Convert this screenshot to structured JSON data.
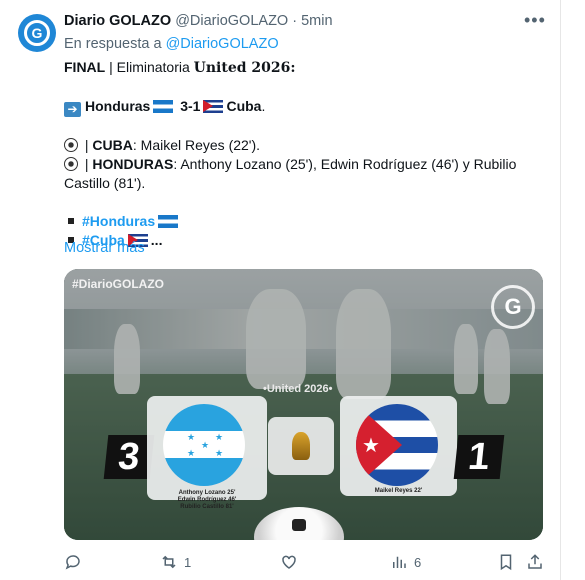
{
  "tweet": {
    "author_name": "Diario GOLAZO",
    "author_handle": "@DiarioGOLAZO",
    "time": "· 5min",
    "reply_prefix": "En respuesta a",
    "reply_to": "@DiarioGOLAZO",
    "final_label": "FINAL",
    "final_sep": " | Eliminatoria ",
    "final_event": "United 2026:",
    "score_team1": "Honduras",
    "score_text": "3-1",
    "score_team2": "Cuba",
    "cuba_label": "CUBA",
    "cuba_scorers": ": Maikel Reyes (22').",
    "honduras_label": "HONDURAS",
    "honduras_scorers_1": ": Anthony Lozano (25'), Edwin Rodríguez (46') y Rubilio",
    "honduras_scorers_2": "Castillo (81').",
    "hashtag1": "#Honduras",
    "hashtag2": "#Cuba",
    "hashtag2_tail": "...",
    "show_more": "Mostrar más",
    "more_icon": "•••",
    "avatar_letter": "G",
    "bar_sep": " | "
  },
  "media": {
    "tag": "#DiarioGOLAZO",
    "event": "•United 2026•",
    "logo": "G",
    "home_score": "3",
    "away_score": "1",
    "home_scorers": [
      "Anthony Lozano 25'",
      "Edwin Rodríguez 46'",
      "Rubilio Castillo 81'"
    ],
    "away_scorers": [
      "Maikel Reyes 22'"
    ]
  },
  "actions": {
    "replies_icon": "reply-icon",
    "retweet_count": "1",
    "like_icon": "heart-icon",
    "views_count": "6"
  },
  "colors": {
    "link": "#1d9bf0",
    "muted": "#536471",
    "accent": "#1f87d6"
  }
}
